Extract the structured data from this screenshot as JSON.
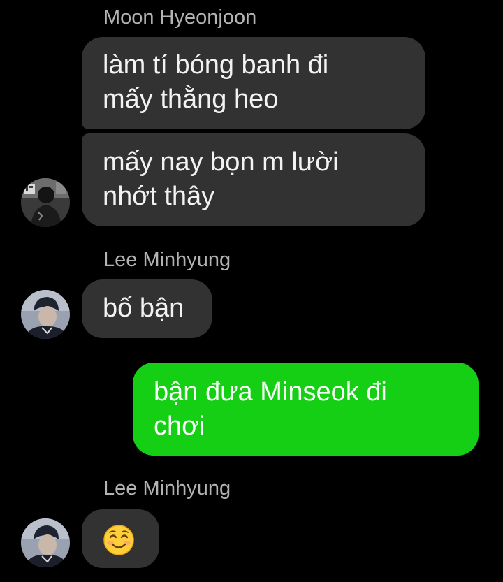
{
  "messages": [
    {
      "sender": "Moon Hyeonjoon",
      "bubbles": [
        {
          "lines": [
            "làm tí bóng banh đi",
            "mấy thằng heo"
          ]
        },
        {
          "lines": [
            "mấy nay bọn m lười",
            "nhớt thây"
          ]
        }
      ],
      "avatar": "avatar-icon"
    },
    {
      "sender": "Lee Minhyung",
      "bubbles": [
        {
          "lines": [
            "bố bận"
          ]
        }
      ],
      "avatar": "avatar-icon"
    },
    {
      "sender": "",
      "outgoing": true,
      "bubbles": [
        {
          "lines": [
            "bận đưa Minseok đi",
            "chơi"
          ]
        }
      ]
    },
    {
      "sender": "Lee Minhyung",
      "bubbles": [
        {
          "emoji": "smiling-face-with-smiling-eyes-icon"
        }
      ],
      "avatar": "avatar-icon"
    }
  ],
  "colors": {
    "background": "#000000",
    "incoming_bubble": "#323232",
    "outgoing_bubble": "#15cf15",
    "sender_name": "#b3b3b3",
    "text": "#f2f2f2"
  }
}
